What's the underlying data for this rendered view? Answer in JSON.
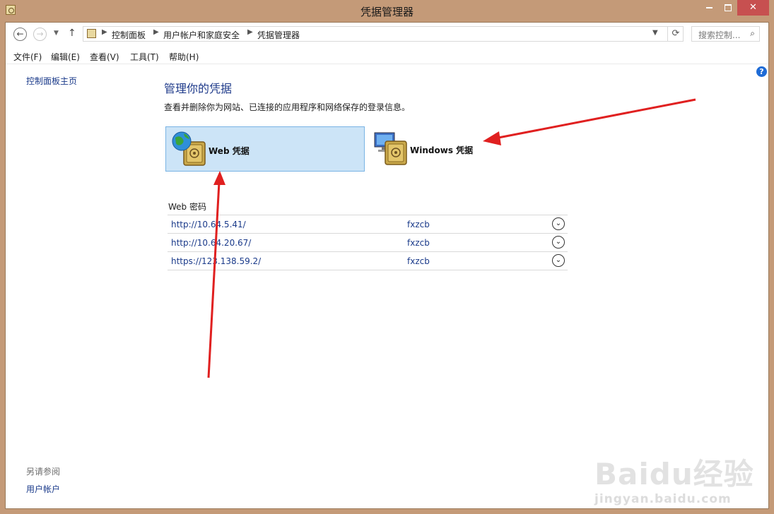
{
  "window": {
    "title": "凭据管理器"
  },
  "address": {
    "crumbs": [
      "控制面板",
      "用户帐户和家庭安全",
      "凭据管理器"
    ],
    "search_placeholder": "搜索控制..."
  },
  "menu": [
    "文件(F)",
    "编辑(E)",
    "查看(V)",
    "工具(T)",
    "帮助(H)"
  ],
  "sidebar": {
    "home_link": "控制面板主页",
    "see_also_label": "另请参阅",
    "see_also_link": "用户帐户"
  },
  "main": {
    "heading": "管理你的凭据",
    "description": "查看并删除你为网站、已连接的应用程序和网络保存的登录信息。",
    "tiles": [
      {
        "label": "Web 凭据",
        "selected": true
      },
      {
        "label": "Windows 凭据",
        "selected": false
      }
    ],
    "section_title": "Web 密码",
    "credentials": [
      {
        "url": "http://10.64.5.41/",
        "user": "fxzcb"
      },
      {
        "url": "http://10.64.20.67/",
        "user": "fxzcb"
      },
      {
        "url": "https://123.138.59.2/",
        "user": "fxzcb"
      }
    ]
  },
  "watermark": {
    "main": "Baidu经验",
    "sub": "jingyan.baidu.com"
  },
  "colors": {
    "frame": "#c49a78",
    "selected_tile": "#cce4f7",
    "link": "#1a3a8a",
    "arrow": "#e02020"
  },
  "icons": [
    "back-icon",
    "forward-icon",
    "up-icon",
    "refresh-icon",
    "search-icon",
    "help-icon",
    "globe-safe-icon",
    "computer-safe-icon",
    "expand-icon"
  ]
}
